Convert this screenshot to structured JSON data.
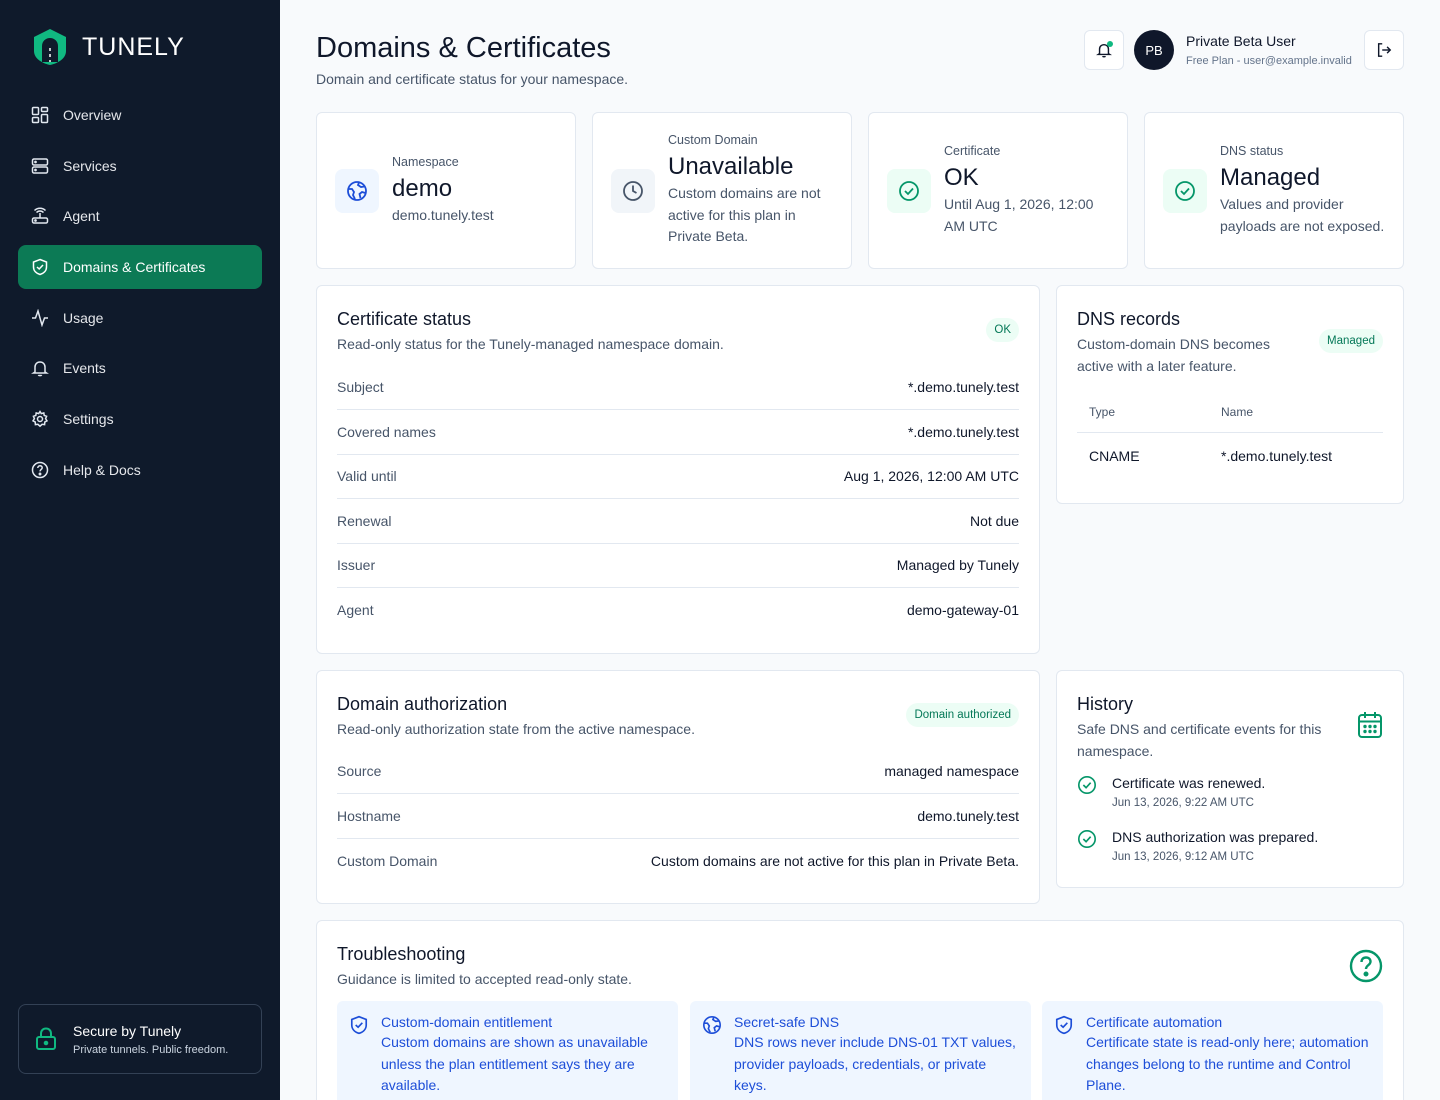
{
  "brand": {
    "name": "TUNELY"
  },
  "sidebar": {
    "items": [
      {
        "label": "Overview",
        "icon": "grid-icon"
      },
      {
        "label": "Services",
        "icon": "server-icon"
      },
      {
        "label": "Agent",
        "icon": "router-icon"
      },
      {
        "label": "Domains & Certificates",
        "icon": "shield-icon",
        "active": true
      },
      {
        "label": "Usage",
        "icon": "activity-icon"
      },
      {
        "label": "Events",
        "icon": "bell-icon"
      },
      {
        "label": "Settings",
        "icon": "gear-icon"
      },
      {
        "label": "Help & Docs",
        "icon": "help-icon"
      }
    ],
    "secure": {
      "title": "Secure by Tunely",
      "subtitle": "Private tunnels. Public freedom."
    }
  },
  "header": {
    "title": "Domains & Certificates",
    "subtitle": "Domain and certificate status for your namespace.",
    "user": {
      "initials": "PB",
      "name": "Private Beta User",
      "plan": "Free Plan - user@example.invalid"
    }
  },
  "stats": {
    "namespace": {
      "label": "Namespace",
      "value": "demo",
      "detail": "demo.tunely.test"
    },
    "custom_domain": {
      "label": "Custom Domain",
      "value": "Unavailable",
      "detail": "Custom domains are not active for this plan in Private Beta."
    },
    "certificate": {
      "label": "Certificate",
      "value": "OK",
      "detail": "Until Aug 1, 2026, 12:00 AM UTC"
    },
    "dns": {
      "label": "DNS status",
      "value": "Managed",
      "detail": "Values and provider payloads are not exposed."
    }
  },
  "cert_status": {
    "title": "Certificate status",
    "subtitle": "Read-only status for the Tunely-managed namespace domain.",
    "badge": "OK",
    "rows": [
      {
        "key": "Subject",
        "value": "*.demo.tunely.test"
      },
      {
        "key": "Covered names",
        "value": "*.demo.tunely.test"
      },
      {
        "key": "Valid until",
        "value": "Aug 1, 2026, 12:00 AM UTC"
      },
      {
        "key": "Renewal",
        "value": "Not due"
      },
      {
        "key": "Issuer",
        "value": "Managed by Tunely"
      },
      {
        "key": "Agent",
        "value": "demo-gateway-01"
      }
    ]
  },
  "dns_records": {
    "title": "DNS records",
    "subtitle": "Custom-domain DNS becomes active with a later feature.",
    "badge": "Managed",
    "columns": [
      "Type",
      "Name"
    ],
    "rows": [
      {
        "type": "CNAME",
        "name": "*.demo.tunely.test"
      }
    ]
  },
  "domain_auth": {
    "title": "Domain authorization",
    "subtitle": "Read-only authorization state from the active namespace.",
    "badge": "Domain authorized",
    "rows": [
      {
        "key": "Source",
        "value": "managed namespace"
      },
      {
        "key": "Hostname",
        "value": "demo.tunely.test"
      },
      {
        "key": "Custom Domain",
        "value": "Custom domains are not active for this plan in Private Beta."
      }
    ]
  },
  "history": {
    "title": "History",
    "subtitle": "Safe DNS and certificate events for this namespace.",
    "events": [
      {
        "title": "Certificate was renewed.",
        "time": "Jun 13, 2026, 9:22 AM UTC"
      },
      {
        "title": "DNS authorization was prepared.",
        "time": "Jun 13, 2026, 9:12 AM UTC"
      }
    ]
  },
  "troubleshooting": {
    "title": "Troubleshooting",
    "subtitle": "Guidance is limited to accepted read-only state.",
    "tips": [
      {
        "title": "Custom-domain entitlement",
        "body": "Custom domains are shown as unavailable unless the plan entitlement says they are available.",
        "icon": "shield-icon"
      },
      {
        "title": "Secret-safe DNS",
        "body": "DNS rows never include DNS-01 TXT values, provider payloads, credentials, or private keys.",
        "icon": "globe-icon"
      },
      {
        "title": "Certificate automation",
        "body": "Certificate state is read-only here; automation changes belong to the runtime and Control Plane.",
        "icon": "shield-icon"
      }
    ]
  },
  "colors": {
    "sidebar_bg": "#0f1a2b",
    "accent": "#0c7a55",
    "success": "#10b981",
    "info": "#1d4ed8"
  }
}
